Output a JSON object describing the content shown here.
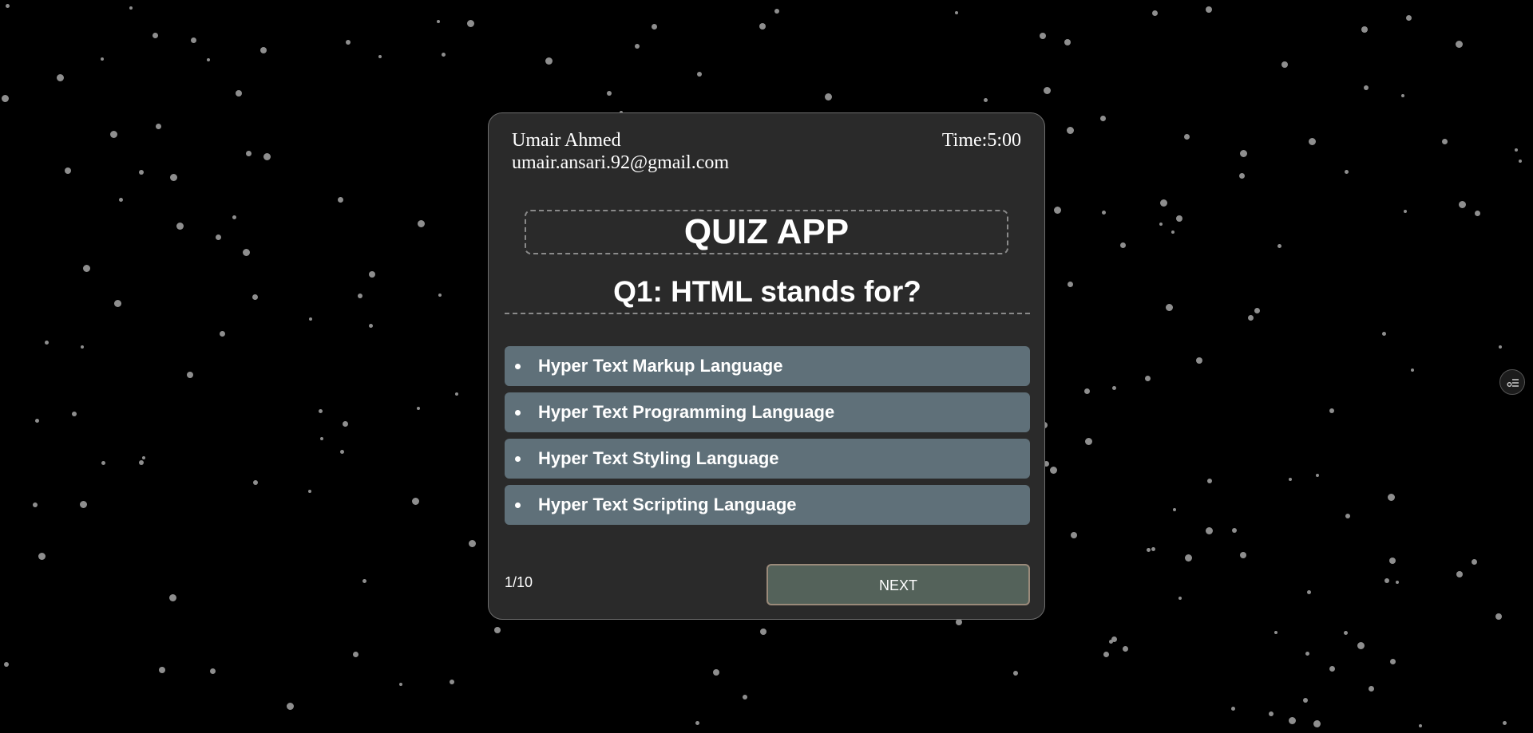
{
  "user": {
    "name": "Umair Ahmed",
    "email": "umair.ansari.92@gmail.com"
  },
  "timer": {
    "text": "Time:5:00"
  },
  "app": {
    "title": "QUIZ APP"
  },
  "question": {
    "text": "Q1: HTML stands for?"
  },
  "options": [
    {
      "label": "Hyper Text Markup Language"
    },
    {
      "label": "Hyper Text Programming Language"
    },
    {
      "label": "Hyper Text Styling Language"
    },
    {
      "label": "Hyper Text Scripting Language"
    }
  ],
  "progress": {
    "text": "1/10"
  },
  "buttons": {
    "next_label": "NEXT"
  },
  "side_control": {
    "icon": "settings-sliders-icon"
  },
  "colors": {
    "background": "#000000",
    "card": "#2a2a2a",
    "option": "#5f7079",
    "next_button": "#54625a",
    "star": "#8e8e8e"
  }
}
